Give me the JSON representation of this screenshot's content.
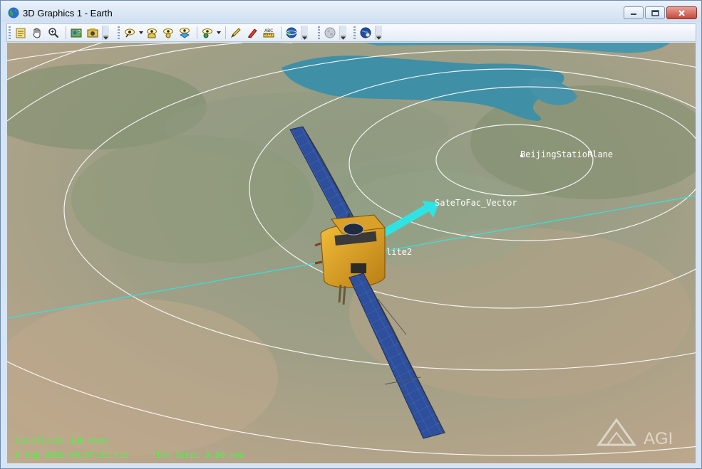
{
  "window": {
    "title": "3D Graphics 1 - Earth"
  },
  "toolbar": {
    "icons": [
      "properties-icon",
      "pan-hand-icon",
      "zoom-icon",
      "map-icon",
      "camera-icon",
      "view-from-icon",
      "home-view-icon",
      "orbit-view-icon",
      "globe-view-icon",
      "view-to-icon",
      "pencil-icon",
      "marker-icon",
      "measure-icon",
      "earth-icon",
      "moon-icon",
      "globe-manager-icon"
    ]
  },
  "scene": {
    "labels": {
      "station": "BeijingStation",
      "plane": "Plane",
      "vector": "SateToFac_Vector",
      "satellite": "lite2"
    },
    "hud": {
      "axes": "Satellite2 ICR Axes",
      "datetime": "5 Sep 2021 09:37:35.616",
      "timestep": "Time Step: 3.00 sec"
    },
    "watermark": "AGI",
    "colors": {
      "hud_text": "#3dff3d",
      "vector": "#2fe3e3",
      "range_rings": "#ffffff",
      "panel": "#2e4f9c",
      "body": "#e0a22a"
    }
  }
}
